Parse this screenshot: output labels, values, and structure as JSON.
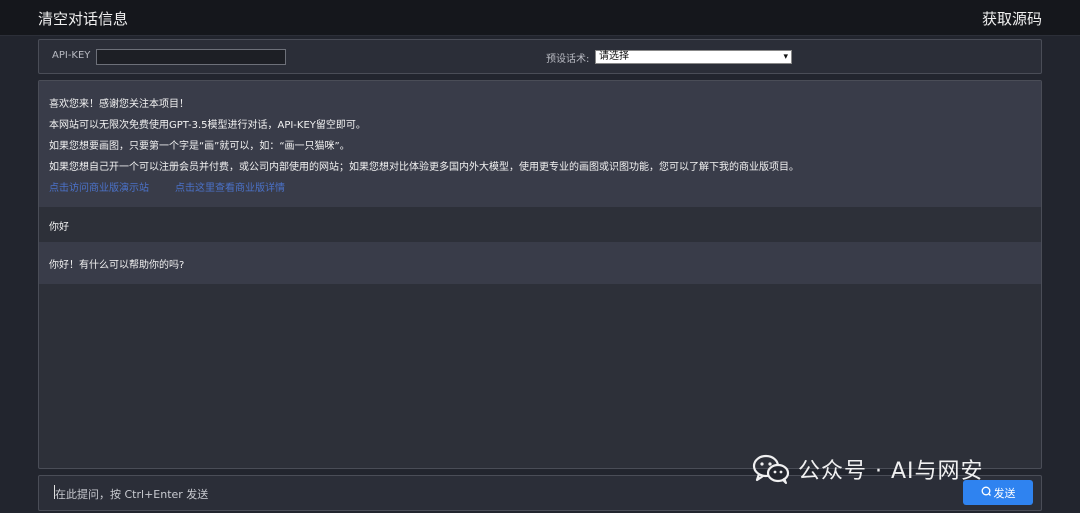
{
  "header": {
    "clear_label": "清空对话信息",
    "source_label": "获取源码"
  },
  "settings": {
    "apikey_label": "API-KEY",
    "apikey_value": "",
    "preset_label": "预设话术:",
    "preset_selected": "请选择"
  },
  "welcome": {
    "lines": [
      "喜欢您来！感谢您关注本项目！",
      "本网站可以无限次免费使用GPT-3.5模型进行对话，API-KEY留空即可。",
      "如果您想要画图，只要第一个字是“画”就可以，如：“画一只猫咪”。",
      "如果您想自己开一个可以注册会员并付费，或公司内部使用的网站；如果您想对比体验更多国内外大模型，使用更专业的画图或识图功能，您可以了解下我的商业版项目。"
    ],
    "links": [
      "点击访问商业版演示站",
      "点击这里查看商业版详情"
    ]
  },
  "messages": [
    {
      "role": "user",
      "text": "你好"
    },
    {
      "role": "assistant",
      "text": "你好！有什么可以帮助你的吗?"
    }
  ],
  "composer": {
    "placeholder": "在此提问，按 Ctrl+Enter 发送",
    "send_label": "发送",
    "send_icon": "send-icon"
  },
  "watermark": {
    "text": "公众号 · AI与网安",
    "icon": "wechat-icon"
  },
  "colors": {
    "accent": "#2f83f0",
    "link": "#4b72c9",
    "background": "#22252e"
  }
}
